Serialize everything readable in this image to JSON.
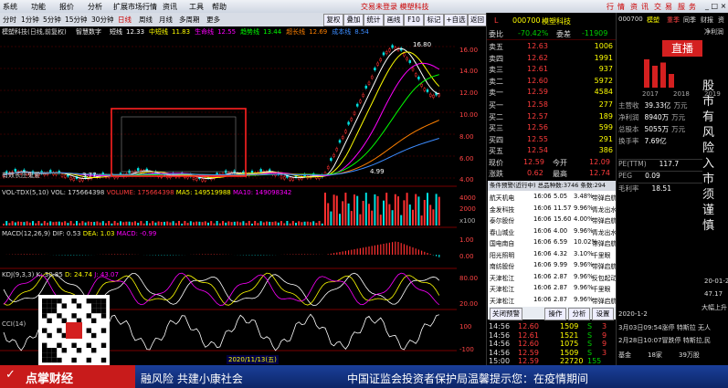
{
  "menu": {
    "items": [
      "系统",
      "功能",
      "报价",
      "分析",
      "扩展市场行情",
      "资讯",
      "工具",
      "帮助"
    ],
    "center_title": "交易未登录 模塑科技",
    "right_items": [
      "行",
      "情",
      "资",
      "讯",
      "交",
      "易",
      "服",
      "务"
    ]
  },
  "toolbar": {
    "periods": [
      "分时",
      "1分钟",
      "5分钟",
      "15分钟",
      "30分钟",
      "日线",
      "周线",
      "月线",
      "多周期",
      "更多"
    ],
    "selected_period": "日线",
    "buttons": [
      "复权",
      "叠加",
      "统计",
      "画线",
      "F10",
      "标记",
      "+自选",
      "返回"
    ]
  },
  "chart_header": {
    "stock_label": "模塑科技(日线,前复权)",
    "indicator_label": "智慧数字",
    "ma": [
      {
        "name": "短线",
        "value": "12.33",
        "color": "#ffffff"
      },
      {
        "name": "中短线",
        "value": "11.83",
        "color": "#ffff00"
      },
      {
        "name": "生命线",
        "value": "12.55",
        "color": "#ff00ff"
      },
      {
        "name": "趋势线",
        "value": "13.44",
        "color": "#00ff00"
      },
      {
        "name": "超长线",
        "value": "12.69",
        "color": "#ff8000"
      },
      {
        "name": "成本线",
        "value": "8.54",
        "color": "#3c8cff"
      }
    ],
    "bottom_left_label": "有效长庄鬼爱"
  },
  "price_axis": {
    "ticks": [
      "16.00",
      "14.00",
      "12.00",
      "10.00",
      "8.00",
      "6.00",
      "4.00"
    ],
    "max": 17.0,
    "min": 3.5
  },
  "annotations": {
    "high": "16.80",
    "low": "3.77",
    "low2": "4.99",
    "mid_labels": [
      "5.33",
      "5.33",
      "8.5",
      "7.74",
      "5.79"
    ]
  },
  "volume_panel": {
    "label": "VOL-TDX(5,10)",
    "vol": "VOL: 175664398",
    "volume": "VOLUME: 175664398",
    "ma5": "MA5: 149519988",
    "ma10": "MA10: 149098342",
    "unit": "x100",
    "ticks": [
      "4000",
      "2000"
    ]
  },
  "macd_panel": {
    "label": "MACD(12,26,9)",
    "dif": "DIF: 0.53",
    "dea": "DEA: 1.03",
    "macd": "MACD: -0.99",
    "ticks": [
      "1.00",
      "0.00"
    ]
  },
  "kdj_panel": {
    "label": "KDJ(9,3,3)",
    "k": "K: 30.85",
    "d": "D: 24.74",
    "j": "J: 43.07",
    "ticks": [
      "80.00",
      "20.00"
    ]
  },
  "cci_panel": {
    "label": "CCI(14)",
    "ticks": [
      "100",
      "-100"
    ]
  },
  "status": {
    "date_label": "2020/11/13(五)",
    "tabs": [
      "日线"
    ]
  },
  "quote": {
    "code": "000700",
    "name": "模塑科技",
    "weibi_label": "委比",
    "weibi": "-70.42%",
    "weicha_label": "委差",
    "weicha": "-11909",
    "asks": [
      {
        "label": "卖五",
        "price": "12.63",
        "vol": "1006"
      },
      {
        "label": "卖四",
        "price": "12.62",
        "vol": "1991"
      },
      {
        "label": "卖三",
        "price": "12.61",
        "vol": "937"
      },
      {
        "label": "卖二",
        "price": "12.60",
        "vol": "5972"
      },
      {
        "label": "卖一",
        "price": "12.59",
        "vol": "4584"
      }
    ],
    "bids": [
      {
        "label": "买一",
        "price": "12.58",
        "vol": "277"
      },
      {
        "label": "买二",
        "price": "12.57",
        "vol": "189"
      },
      {
        "label": "买三",
        "price": "12.56",
        "vol": "599"
      },
      {
        "label": "买四",
        "price": "12.55",
        "vol": "291"
      },
      {
        "label": "买五",
        "price": "12.54",
        "vol": "386"
      }
    ],
    "current_label": "现价",
    "current": "12.59",
    "open_label": "今开",
    "open": "12.09",
    "change_label": "涨跌",
    "change": "0.62",
    "high_label": "最高",
    "high": "12.74",
    "warn_title": "条件预警(近行中)",
    "warn_total": "总品种数:3746",
    "warn_count": "条数:294",
    "warnings": [
      {
        "name": "航天机电",
        "time": "16:06",
        "price": "5.05",
        "pct": "3.48%",
        "type": "带弹启航"
      },
      {
        "name": "金发科技",
        "time": "16:06",
        "price": "11.57",
        "pct": "9.96%",
        "type": "青龙出水"
      },
      {
        "name": "泰尔股份",
        "time": "16:06",
        "price": "15.60",
        "pct": "4.00%",
        "type": "带弹启航"
      },
      {
        "name": "春山城业",
        "time": "16:06",
        "price": "4.00",
        "pct": "9.96%",
        "type": "青龙出水"
      },
      {
        "name": "国电南自",
        "time": "16:06",
        "price": "6.59",
        "pct": "10.02%",
        "type": "带弹启航"
      },
      {
        "name": "阳光照明",
        "time": "16:06",
        "price": "4.32",
        "pct": "3.10%",
        "type": "千里眼"
      },
      {
        "name": "南纺股份",
        "time": "16:06",
        "price": "9.99",
        "pct": "9.96%",
        "type": "带弹启航"
      },
      {
        "name": "天津松江",
        "time": "16:06",
        "price": "2.87",
        "pct": "9.96%",
        "type": "反包起动"
      },
      {
        "name": "天津松江",
        "time": "16:06",
        "price": "2.87",
        "pct": "9.96%",
        "type": "千里眼"
      },
      {
        "name": "天津松江",
        "time": "16:06",
        "price": "2.87",
        "pct": "9.96%",
        "type": "带弹启航"
      }
    ],
    "warn_buttons": [
      "关闭预警",
      "操作",
      "分析",
      "设置"
    ],
    "ticks": [
      {
        "time": "14:56",
        "price": "12.60",
        "vol": "1509",
        "n": "S",
        "m": "3"
      },
      {
        "time": "14:56",
        "price": "12.61",
        "vol": "1521",
        "n": "S",
        "m": "9"
      },
      {
        "time": "14:56",
        "price": "12.60",
        "vol": "1075",
        "n": "S",
        "m": "9"
      },
      {
        "time": "14:56",
        "price": "12.59",
        "vol": "1509",
        "n": "S",
        "m": "3"
      },
      {
        "time": "15:00",
        "price": "12.59",
        "vol": "22720",
        "n": "155",
        "m": ""
      }
    ]
  },
  "side": {
    "code": "000700",
    "name": "模塑",
    "tabs": [
      "重季",
      "同季",
      "财报",
      "资"
    ],
    "label_jlr": "净利润",
    "live_badge": "直播",
    "years": [
      "2017",
      "2018",
      "2019"
    ],
    "bars": [
      0.62,
      0.48,
      0.55,
      0.3
    ],
    "fin": [
      {
        "k": "主营收",
        "v": "39.33亿",
        "u": "万元"
      },
      {
        "k": "净利润",
        "v": "8940万",
        "u": "万元"
      },
      {
        "k": "总股本",
        "v": "5055万",
        "u": "万元"
      },
      {
        "k": "换手率",
        "v": "7.69亿",
        "u": ""
      }
    ],
    "pe": [
      {
        "k": "PE(TTM)",
        "v": "117.7"
      },
      {
        "k": "PEG",
        "v": "0.09"
      },
      {
        "k": "毛利率",
        "v": "18.51"
      }
    ],
    "news": [
      "3月03日09:54涨停 特斯拉 无人",
      "2月28日10:07冒跌停 特斯拉,民",
      "2020-1-2",
      "基金",
      "18家",
      "39万股"
    ],
    "vertical_text": "股市有风险入市须谨慎",
    "extra": [
      "20-01-2",
      "47.17",
      "大幅上升"
    ]
  },
  "ticker": {
    "brand": "点掌财经",
    "text1": "融风险 共建小康社会",
    "text2": "中国证监会投资者保护局温馨提示您：在疫情期间"
  }
}
